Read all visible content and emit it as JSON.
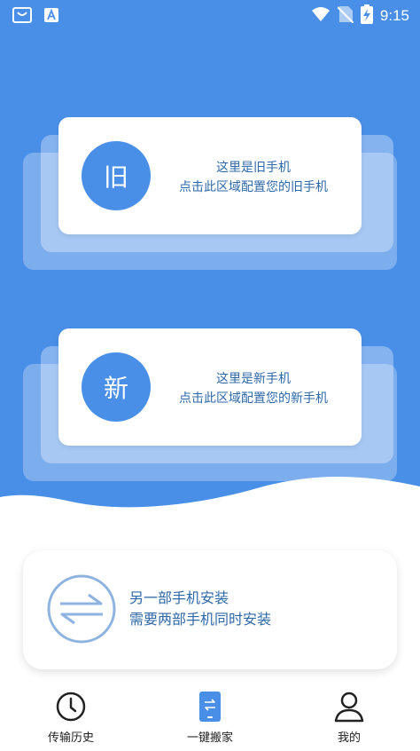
{
  "status_bar": {
    "time": "9:15",
    "icons": [
      "shopping-bag-icon",
      "text-a-icon",
      "wifi-icon",
      "no-sim-icon",
      "battery-charging-icon"
    ]
  },
  "old_phone": {
    "badge": "旧",
    "line1": "这里是旧手机",
    "line2": "点击此区域配置您的旧手机"
  },
  "new_phone": {
    "badge": "新",
    "line1": "这里是新手机",
    "line2": "点击此区域配置您的新手机"
  },
  "install": {
    "line1": "另一部手机安装",
    "line2": "需要两部手机同时安装",
    "icon": "transfer-arrows-icon"
  },
  "nav": {
    "items": [
      {
        "label": "传输历史",
        "icon": "clock-icon"
      },
      {
        "label": "一键搬家",
        "icon": "phone-transfer-icon"
      },
      {
        "label": "我的",
        "icon": "user-icon"
      }
    ]
  },
  "colors": {
    "primary_blue": "#4a8fe7",
    "text_blue": "#2f68a7",
    "white": "#ffffff"
  }
}
